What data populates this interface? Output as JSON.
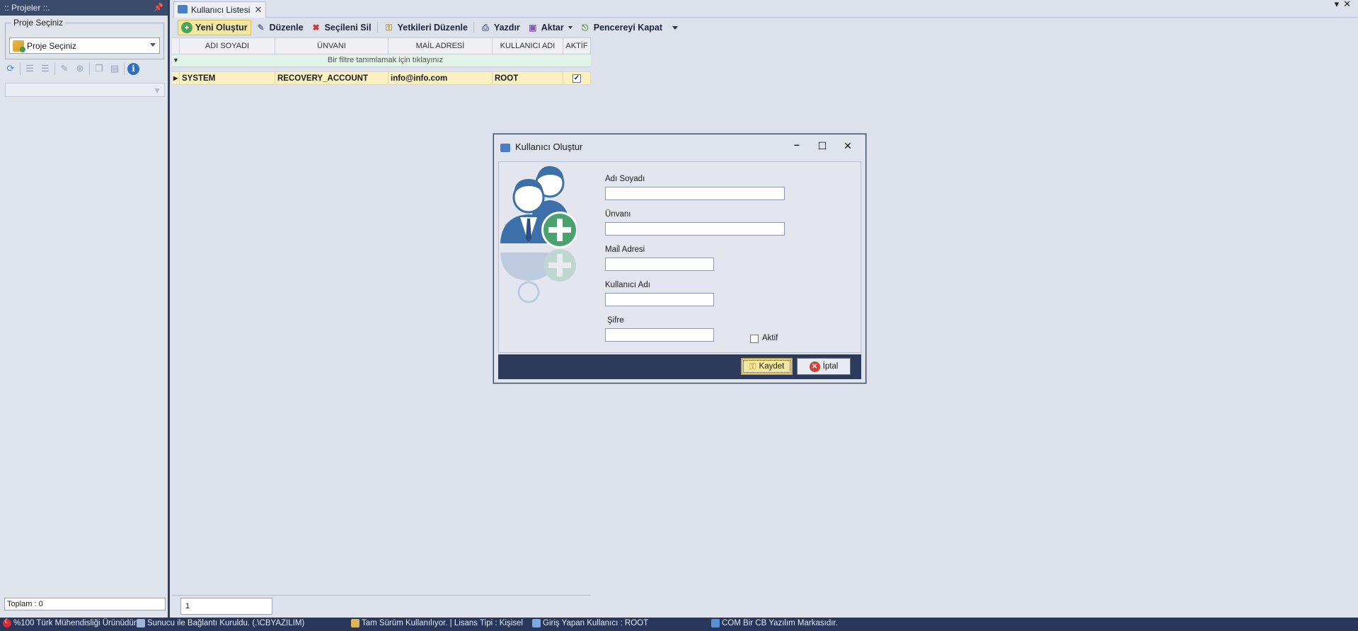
{
  "left_panel": {
    "title": ":: Projeler ::.",
    "group_label": "Proje Seçiniz",
    "project_select_value": "Proje Seçiniz",
    "total": "Toplam : 0"
  },
  "tab": {
    "label": "Kullanıcı Listesi"
  },
  "toolbar": {
    "new": "Yeni Oluştur",
    "edit": "Düzenle",
    "delete_selected": "Seçileni Sil",
    "edit_permissions": "Yetkileri Düzenle",
    "print": "Yazdır",
    "export": "Aktar",
    "close_window": "Pencereyi Kapat"
  },
  "grid": {
    "columns": [
      "ADI SOYADI",
      "ÜNVANI",
      "MAİL ADRESİ",
      "KULLANICI ADI",
      "AKTİF"
    ],
    "filter_prompt": "Bir filtre tanımlamak için tıklayınız",
    "rows": [
      {
        "name": "SYSTEM",
        "title": "RECOVERY_ACCOUNT",
        "email": "info@info.com",
        "username": "ROOT",
        "active": true
      }
    ],
    "pager_value": "1"
  },
  "dialog": {
    "title": "Kullanıcı Oluştur",
    "fields": {
      "name_label": "Adı Soyadı",
      "title_label": "Ünvanı",
      "email_label": "Mail Adresi",
      "username_label": "Kullanıcı Adı",
      "password_label": "Şifre",
      "active_label": "Aktif"
    },
    "save_label": "Kaydet",
    "cancel_label": "İptal"
  },
  "status_bar": {
    "made_in": "%100 Türk Mühendisliği Ürünüdür.",
    "connection": "Sunucu ile Bağlantı Kuruldu. (.\\CBYAZILIM)",
    "license": "Tam Sürüm Kullanılıyor. | Lisans Tipi : Kişisel",
    "logged_user": "Giriş Yapan Kullanıcı : ROOT",
    "brand": "COM Bir CB Yazılım Markasıdır."
  },
  "colors": {
    "accent_yellow": "#f6e89a",
    "dark_navy": "#27365a",
    "row_highlight": "#fbf0c2",
    "filter_row": "#e3f3e6"
  }
}
